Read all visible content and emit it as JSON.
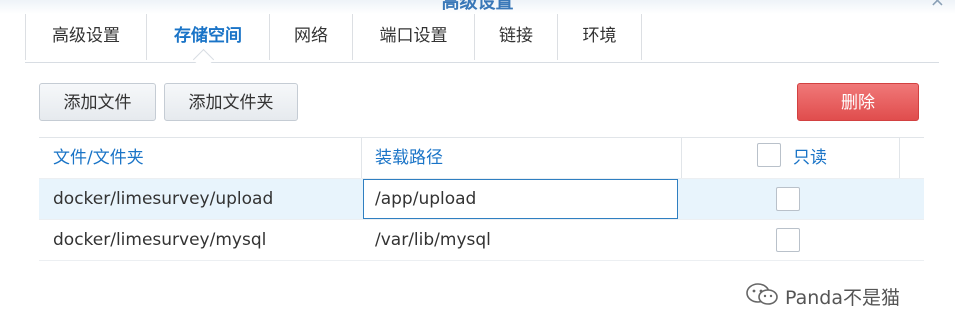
{
  "window": {
    "title": "高级设置",
    "close_glyph": "×"
  },
  "tabs": [
    {
      "label": "高级设置",
      "active": false
    },
    {
      "label": "存储空间",
      "active": true
    },
    {
      "label": "网络",
      "active": false
    },
    {
      "label": "端口设置",
      "active": false
    },
    {
      "label": "链接",
      "active": false
    },
    {
      "label": "环境",
      "active": false
    }
  ],
  "toolbar": {
    "add_file_label": "添加文件",
    "add_folder_label": "添加文件夹",
    "delete_label": "删除"
  },
  "table": {
    "columns": {
      "file_folder": "文件/文件夹",
      "mount_path": "装载路径",
      "readonly": "只读"
    },
    "rows": [
      {
        "file_folder": "docker/limesurvey/upload",
        "mount_path": "/app/upload",
        "readonly": false,
        "selected": true,
        "editing": true
      },
      {
        "file_folder": "docker/limesurvey/mysql",
        "mount_path": "/var/lib/mysql",
        "readonly": false,
        "selected": false,
        "editing": false
      }
    ]
  },
  "watermark": {
    "text": "Panda不是猫",
    "icon": "wechat-icon"
  },
  "colors": {
    "accent": "#1a74c7",
    "danger": "#e04d4d",
    "selected_row": "#e8f4fc"
  }
}
